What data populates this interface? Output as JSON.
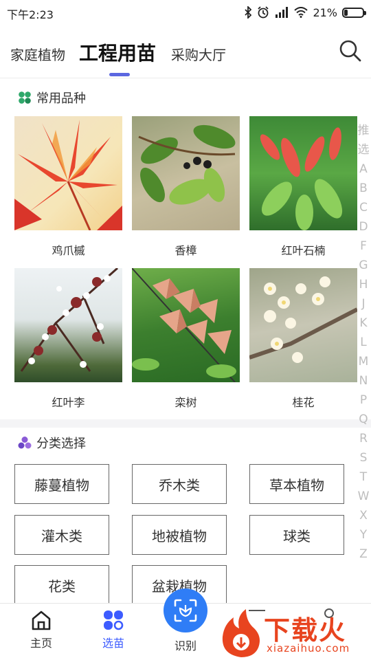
{
  "status_bar": {
    "time": "下午2:23",
    "battery": "21%",
    "battery_level": 0.21
  },
  "header": {
    "tabs": [
      {
        "label": "家庭植物"
      },
      {
        "label": "工程用苗"
      },
      {
        "label": "采购大厅"
      }
    ]
  },
  "common_varieties": {
    "title": "常用品种",
    "plants": [
      {
        "name": "鸡爪槭"
      },
      {
        "name": "香樟"
      },
      {
        "name": "红叶石楠"
      },
      {
        "name": "红叶李"
      },
      {
        "name": "栾树"
      },
      {
        "name": "桂花"
      }
    ]
  },
  "category_select": {
    "title": "分类选择",
    "items": [
      {
        "label": "藤蔓植物"
      },
      {
        "label": "乔木类"
      },
      {
        "label": "草本植物"
      },
      {
        "label": "灌木类"
      },
      {
        "label": "地被植物"
      },
      {
        "label": "球类"
      },
      {
        "label": "花类"
      },
      {
        "label": "盆栽植物"
      }
    ]
  },
  "alphabet_index": [
    "推",
    "选",
    "A",
    "B",
    "C",
    "D",
    "F",
    "G",
    "H",
    "J",
    "K",
    "L",
    "M",
    "N",
    "P",
    "Q",
    "R",
    "S",
    "T",
    "W",
    "X",
    "Y",
    "Z"
  ],
  "bottom_nav": {
    "home": "主页",
    "select": "选苗",
    "scan": "识别"
  },
  "watermark": {
    "text": "下载火",
    "sub": "xiazaihuo.com"
  },
  "colors": {
    "accent": "#5b67e0",
    "nav_active": "#3d5cff",
    "scan": "#2f7df6",
    "watermark": "#e8441f"
  }
}
